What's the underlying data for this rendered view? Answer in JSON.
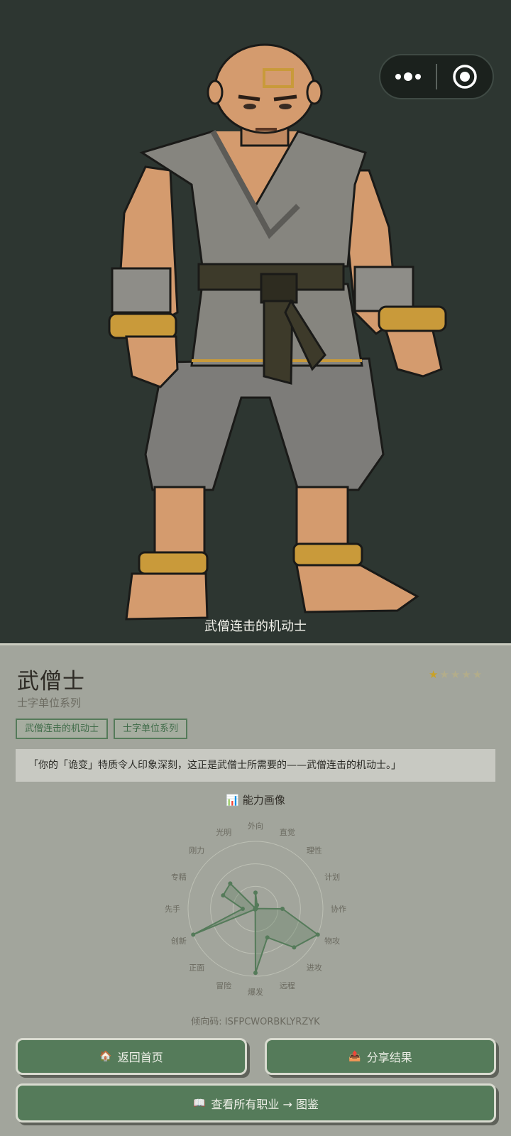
{
  "hero": {
    "caption": "武僧连击的机动士",
    "image_alt": "pixel-art monk fighter"
  },
  "capsule": {
    "more_icon": "more-dots-icon",
    "close_icon": "target-icon"
  },
  "job": {
    "title": "武僧士",
    "series": "士字单位系列",
    "stars": {
      "filled": 1,
      "total": 5,
      "color": "#c9a227",
      "empty_color": "#b3ad8a"
    },
    "tags": [
      "武僧连击的机动士",
      "士字单位系列"
    ],
    "quote": "「你的「诡变」特质令人印象深刻，这正是武僧士所需要的——武僧连击的机动士。」"
  },
  "ability": {
    "title": "能力画像",
    "icon": "bar-chart-icon",
    "code_label": "倾向码: ISFPCWORBKLYRZYK"
  },
  "chart_data": {
    "type": "radar",
    "axes": [
      "外向",
      "直觉",
      "理性",
      "计划",
      "协作",
      "物攻",
      "进攻",
      "远程",
      "爆发",
      "冒险",
      "正面",
      "创新",
      "先手",
      "专精",
      "刚力",
      "光明"
    ],
    "values": [
      0.24,
      0.06,
      0.01,
      0.01,
      0.4,
      1.0,
      0.81,
      0.46,
      0.95,
      0.01,
      0.01,
      1.0,
      0.19,
      0.52,
      0.53,
      0.01
    ],
    "max": 1,
    "colors": {
      "series": "#557b5a",
      "grid": "#bdc0b5",
      "label": "#6b6a60"
    }
  },
  "buttons": {
    "home": {
      "label": "返回首页",
      "icon": "home-icon"
    },
    "share": {
      "label": "分享结果",
      "icon": "share-icon"
    },
    "codex": {
      "label": "查看所有职业 → 图鉴",
      "icon": "book-icon"
    }
  }
}
